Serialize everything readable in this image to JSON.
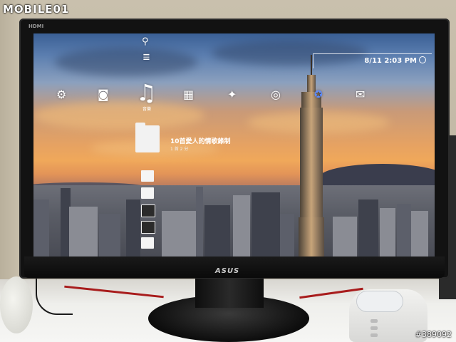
{
  "watermark": {
    "text": "MOBILE01"
  },
  "photo_id": "#389092",
  "monitor": {
    "brand": "ASUS",
    "input_label": "HDMI"
  },
  "ps3_xmb": {
    "clock": "8/11 2:03 PM",
    "category_icons": [
      {
        "name": "settings-icon",
        "glyph": "⚙"
      },
      {
        "name": "photo-icon",
        "glyph": "◙"
      },
      {
        "name": "music-icon",
        "glyph": "♫"
      },
      {
        "name": "video-icon",
        "glyph": "▦"
      },
      {
        "name": "game-icon",
        "glyph": "✦"
      },
      {
        "name": "network-icon",
        "glyph": "◎"
      },
      {
        "name": "playstation-network-icon",
        "glyph": "✪"
      },
      {
        "name": "friends-icon",
        "glyph": "✉"
      }
    ],
    "selected_category_label": "音樂",
    "selected_item": {
      "title": "10首愛人的情歌錄制",
      "subtitle": "1 首 2 分"
    }
  }
}
